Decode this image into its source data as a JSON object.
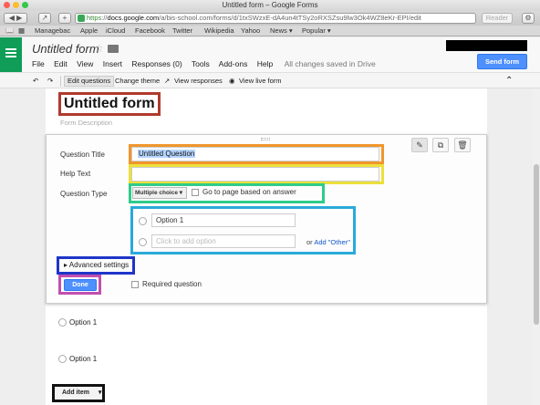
{
  "window": {
    "title": "Untitled form – Google Forms"
  },
  "browser": {
    "url_scheme": "https",
    "url_host": "docs.google.com",
    "url_path": "/a/bis-school.com/forms/d/1txSWzxE-dA4un4tTSy2oRXSZsu9lw3Ok4WZ8eKr-EPI/edit",
    "reader_label": "Reader",
    "bookmarks": [
      "Managebac",
      "Apple",
      "iCloud",
      "Facebook",
      "Twitter",
      "Wikipedia",
      "Yahoo",
      "News ▾",
      "Popular ▾"
    ]
  },
  "app": {
    "doc_title": "Untitled form",
    "menu": [
      "File",
      "Edit",
      "View",
      "Insert",
      "Responses (0)",
      "Tools",
      "Add-ons",
      "Help"
    ],
    "save_status": "All changes saved in Drive",
    "send_label": "Send form"
  },
  "toolbar": {
    "edit_questions": "Edit questions",
    "change_theme": "Change theme",
    "view_responses": "View responses",
    "view_live_form": "View live form"
  },
  "form": {
    "title": "Untitled form",
    "description_placeholder": "Form Description"
  },
  "question": {
    "title_label": "Question Title",
    "title_value": "Untitled Question",
    "help_label": "Help Text",
    "type_label": "Question Type",
    "type_value": "Multiple choice",
    "goto_label": "Go to page based on answer",
    "option1": "Option 1",
    "add_option_placeholder": "Click to add option",
    "or_text": "or",
    "add_other": "Add \"Other\"",
    "advanced_label": "Advanced settings",
    "done_label": "Done",
    "required_label": "Required question"
  },
  "items": [
    {
      "label": "Option 1"
    },
    {
      "label": "Option 1"
    }
  ],
  "add_item_label": "Add item",
  "colors": {
    "title_highlight": "#b03a2e",
    "question_title_highlight": "#f0962c",
    "help_text_highlight": "#ede03a",
    "type_highlight": "#2ecc8a",
    "options_highlight": "#2aaad8",
    "advanced_highlight": "#1f35c9",
    "done_highlight": "#c04fb0",
    "add_item_highlight": "#111111"
  }
}
